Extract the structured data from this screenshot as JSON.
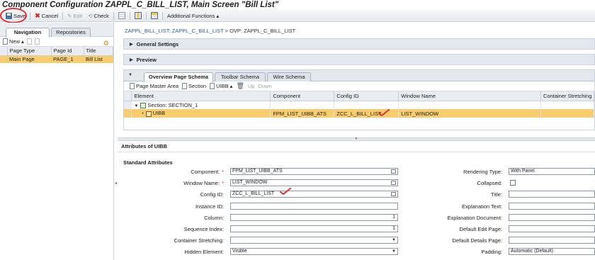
{
  "window": {
    "title": "Component Configuration ZAPPL_C_BILL_LIST, Main Screen \"Bill List\""
  },
  "toolbar": {
    "save": "Save",
    "cancel": "Cancel",
    "edit": "Edit",
    "check": "Check",
    "additional": "Additional Functions ▴"
  },
  "left": {
    "tabs": [
      "Navigation",
      "Repositories"
    ],
    "new_label": "New ▴",
    "columns": [
      "Page Type",
      "Page Id",
      "Title"
    ],
    "rows": [
      [
        "Main Page",
        "PAGE_1",
        "Bill List"
      ]
    ]
  },
  "breadcrumb": {
    "link": "ZAPPL_BILL_LIST: ZAPPL_C_BILL_LIST",
    "sep": " > ",
    "current": "OVP: ZAPPL_C_BILL_LIST"
  },
  "panels": {
    "general": "General Settings",
    "preview": "Preview"
  },
  "schema": {
    "tabs": [
      "Overview Page Schema",
      "Toolbar Schema",
      "Wire Schema"
    ],
    "tools": {
      "page_master": "Page Master Area",
      "section": "Section",
      "uibb": "UIBB ▴",
      "up": "Up",
      "down": "Down"
    },
    "columns": [
      "Element",
      "Component",
      "Config ID",
      "Window Name",
      "Container Stretching"
    ],
    "section_row": "Section: SECTION_1",
    "uibb_row": {
      "element": "UIBB",
      "component": "FPM_LIST_UIBB_ATS",
      "config_id": "ZCC_L_BILL_LIST",
      "window": "LIST_WINDOW",
      "stretching": ""
    }
  },
  "attributes": {
    "header": "Attributes of UIBB",
    "section": "Standard Attributes",
    "left_fields": [
      {
        "label": "Component:",
        "required": true,
        "value": "FPM_LIST_UIBB_ATS",
        "kind": "text"
      },
      {
        "label": "Window Name:",
        "required": true,
        "value": "LIST_WINDOW",
        "kind": "text"
      },
      {
        "label": "Config ID:",
        "required": false,
        "value": "ZCC_L_BILL_LIST",
        "kind": "text"
      },
      {
        "label": "Instance ID:",
        "required": false,
        "value": "",
        "kind": "plain"
      },
      {
        "label": "Column:",
        "required": false,
        "value": "1",
        "kind": "num"
      },
      {
        "label": "Sequence Index:",
        "required": false,
        "value": "1",
        "kind": "num"
      },
      {
        "label": "Container Stretching:",
        "required": false,
        "value": "",
        "kind": "select"
      },
      {
        "label": "Hidden Element:",
        "required": false,
        "value": "Visible",
        "kind": "select"
      }
    ],
    "right_fields": [
      {
        "label": "Rendering Type:",
        "value": "With Panel",
        "kind": "plain"
      },
      {
        "label": "Collapsed:",
        "value": "",
        "kind": "check"
      },
      {
        "label": "Title:",
        "value": "",
        "kind": "plain"
      },
      {
        "label": "Explanation Text:",
        "value": "",
        "kind": "plain"
      },
      {
        "label": "Explanation Document:",
        "value": "",
        "kind": "plain"
      },
      {
        "label": "Default Edit Page:",
        "value": "",
        "kind": "plain"
      },
      {
        "label": "Default Details Page:",
        "value": "",
        "kind": "plain"
      },
      {
        "label": "Padding:",
        "value": "Automatic (Default)",
        "kind": "plain"
      }
    ]
  },
  "colors": {
    "selection": "#f9cd6e",
    "annotation": "#e03030"
  }
}
